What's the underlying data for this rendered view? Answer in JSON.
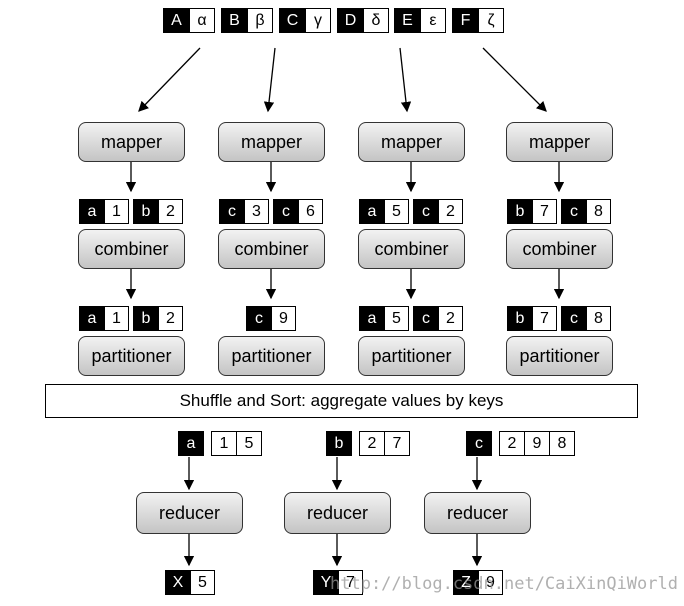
{
  "inputs": [
    [
      "A",
      "α"
    ],
    [
      "B",
      "β"
    ],
    [
      "C",
      "γ"
    ],
    [
      "D",
      "δ"
    ],
    [
      "E",
      "ε"
    ],
    [
      "F",
      "ζ"
    ]
  ],
  "labels": {
    "mapper": "mapper",
    "combiner": "combiner",
    "partitioner": "partitioner",
    "reducer": "reducer"
  },
  "columns": [
    {
      "map_out": [
        [
          "a",
          "1"
        ],
        [
          "b",
          "2"
        ]
      ],
      "combine_out": [
        [
          "a",
          "1"
        ],
        [
          "b",
          "2"
        ]
      ]
    },
    {
      "map_out": [
        [
          "c",
          "3"
        ],
        [
          "c",
          "6"
        ]
      ],
      "combine_out": [
        [
          "c",
          "9"
        ]
      ]
    },
    {
      "map_out": [
        [
          "a",
          "5"
        ],
        [
          "c",
          "2"
        ]
      ],
      "combine_out": [
        [
          "a",
          "5"
        ],
        [
          "c",
          "2"
        ]
      ]
    },
    {
      "map_out": [
        [
          "b",
          "7"
        ],
        [
          "c",
          "8"
        ]
      ],
      "combine_out": [
        [
          "b",
          "7"
        ],
        [
          "c",
          "8"
        ]
      ]
    }
  ],
  "shuffle": "Shuffle and Sort: aggregate values by keys",
  "reducers": [
    {
      "key": "a",
      "values": [
        "1",
        "5"
      ],
      "output": [
        "X",
        "5"
      ]
    },
    {
      "key": "b",
      "values": [
        "2",
        "7"
      ],
      "output": [
        "Y",
        "7"
      ]
    },
    {
      "key": "c",
      "values": [
        "2",
        "9",
        "8"
      ],
      "output": [
        "Z",
        "9"
      ]
    }
  ],
  "watermark": "http://blog.csdn.net/CaiXinQiWorld"
}
